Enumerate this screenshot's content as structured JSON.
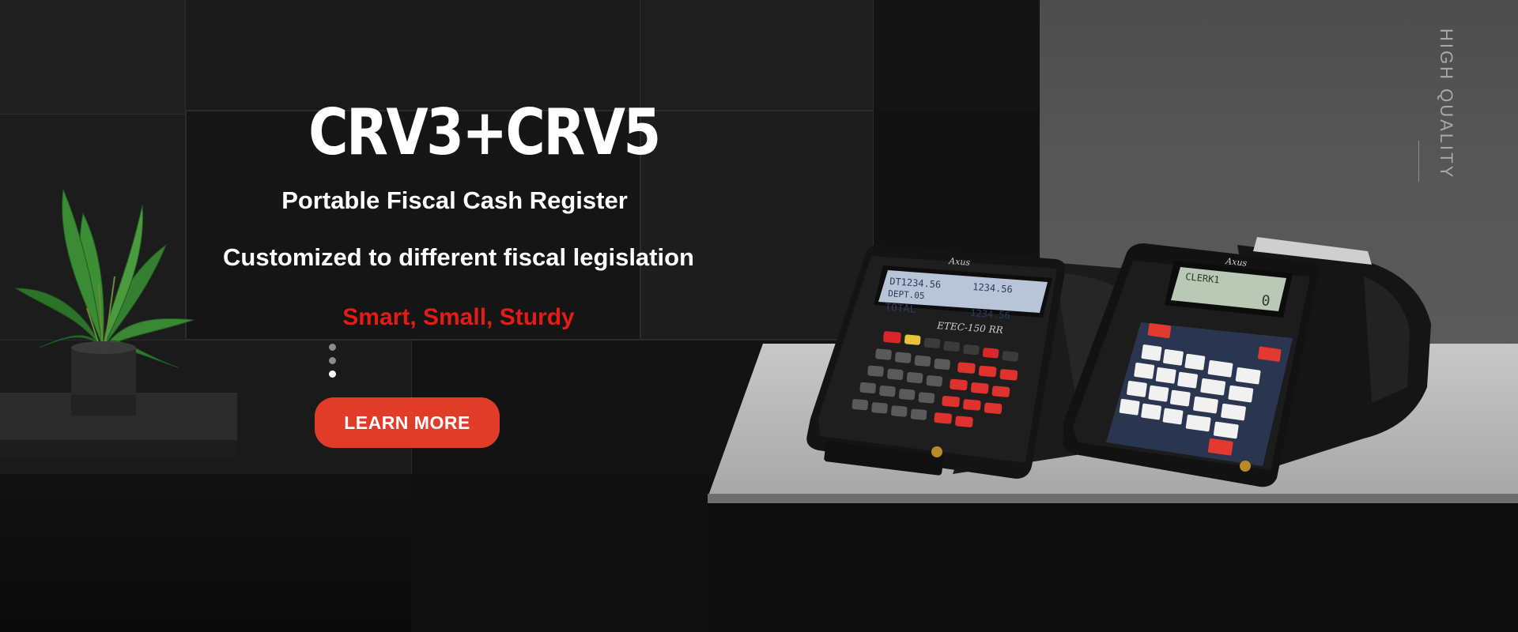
{
  "hero": {
    "title": "CRV3+CRV5",
    "subtitle": "Portable Fiscal Cash Register",
    "tagline": "Customized to different fiscal legislation",
    "features": "Smart, Small, Sturdy",
    "cta_label": "LEARN MORE",
    "side_label": "HIGH QUALITY",
    "pager": {
      "dot_count": 3,
      "active_index": 2
    }
  },
  "devices": {
    "left": {
      "brand": "Axus",
      "model": "ETEC-150 RR",
      "display_lines": [
        "DEPT.05",
        "TOTAL"
      ],
      "display_values": [
        "1234.56",
        "1234.56",
        "1234.56"
      ],
      "display_top_left": "DT1234.56"
    },
    "right": {
      "brand": "Axus",
      "display_line": "CLERK1",
      "display_value": "0"
    }
  },
  "colors": {
    "accent_red": "#e51c16",
    "cta_red": "#e13b2a",
    "text_white": "#ffffff",
    "dot_inactive": "#8c8c8c",
    "dot_active": "#ffffff",
    "lcd_green": "#b9c9b6",
    "lcd_blue": "#b8c4d8"
  },
  "icons": [
    "plant-icon",
    "cash-register-icon"
  ]
}
